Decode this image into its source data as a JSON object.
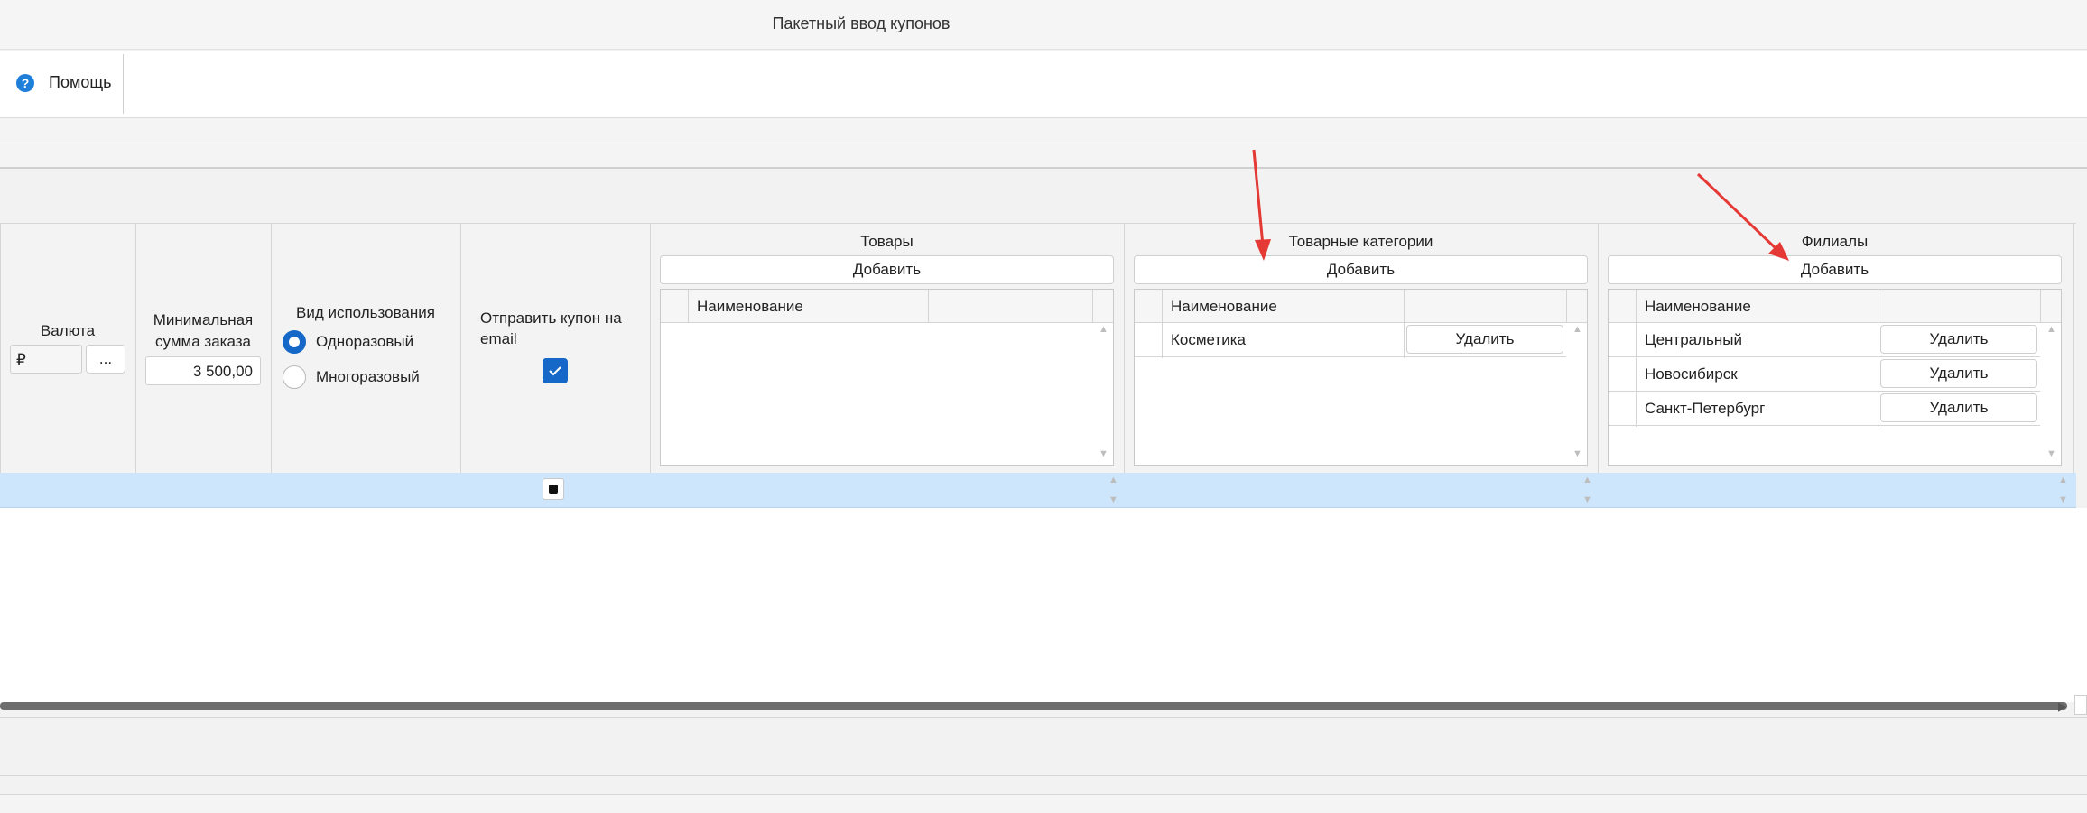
{
  "window": {
    "title": "Пакетный ввод купонов"
  },
  "toolbar": {
    "help_label": "Помощь",
    "help_icon": "help-circle-icon",
    "help_icon_glyph": "?"
  },
  "columns": {
    "currency": {
      "header": "Валюта",
      "value": "₽",
      "select_button": "..."
    },
    "min_order": {
      "header_line1": "Минимальная",
      "header_line2": "сумма заказа",
      "value": "3 500,00"
    },
    "usage_type": {
      "header": "Вид использования",
      "options": [
        {
          "label": "Одноразовый",
          "selected": true
        },
        {
          "label": "Многоразовый",
          "selected": false
        }
      ]
    },
    "send_email": {
      "header_line1": "Отправить купон на",
      "header_line2": "email",
      "checked": true
    },
    "products": {
      "header": "Товары",
      "add_button": "Добавить",
      "name_column": "Наименование",
      "rows": []
    },
    "categories": {
      "header": "Товарные категории",
      "add_button": "Добавить",
      "name_column": "Наименование",
      "rows": [
        {
          "name": "Косметика",
          "delete_button": "Удалить"
        }
      ]
    },
    "branches": {
      "header": "Филиалы",
      "add_button": "Добавить",
      "name_column": "Наименование",
      "rows": [
        {
          "name": "Центральный",
          "delete_button": "Удалить"
        },
        {
          "name": "Новосибирск",
          "delete_button": "Удалить"
        },
        {
          "name": "Санкт-Петербург",
          "delete_button": "Удалить"
        }
      ]
    }
  },
  "colors": {
    "accent": "#1568c7",
    "selection": "#cde6fb",
    "annotation_arrow": "#e53935"
  }
}
